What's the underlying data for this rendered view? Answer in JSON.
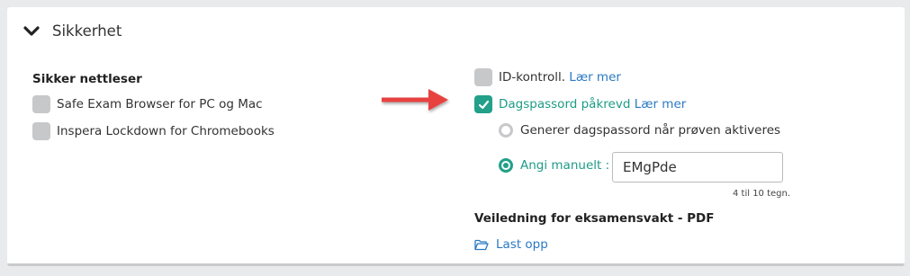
{
  "section": {
    "title": "Sikkerhet",
    "icon": "chevron-down-icon"
  },
  "secure_browser": {
    "title": "Sikker nettleser",
    "options": [
      {
        "label": "Safe Exam Browser for PC og Mac",
        "checked": false
      },
      {
        "label": "Inspera Lockdown for Chromebooks",
        "checked": false
      }
    ]
  },
  "id_control": {
    "label": "ID-kontroll.",
    "link": "Lær mer",
    "checked": false
  },
  "day_password": {
    "label": "Dagspassord påkrevd",
    "link": "Lær mer",
    "checked": true,
    "options": {
      "generate": {
        "label": "Generer dagspassord når prøven aktiveres",
        "selected": false
      },
      "manual": {
        "label": "Angi manuelt :",
        "selected": true
      }
    },
    "input_value": "EMgPde",
    "hint": "4 til 10 tegn."
  },
  "guide": {
    "title": "Veiledning for eksamensvakt - PDF",
    "upload_label": "Last opp",
    "upload_icon": "folder-open-icon"
  },
  "colors": {
    "accent": "#22a089",
    "link": "#2a79c4",
    "arrow": "#e8423f",
    "checkbox_off": "#c7c8ca"
  }
}
